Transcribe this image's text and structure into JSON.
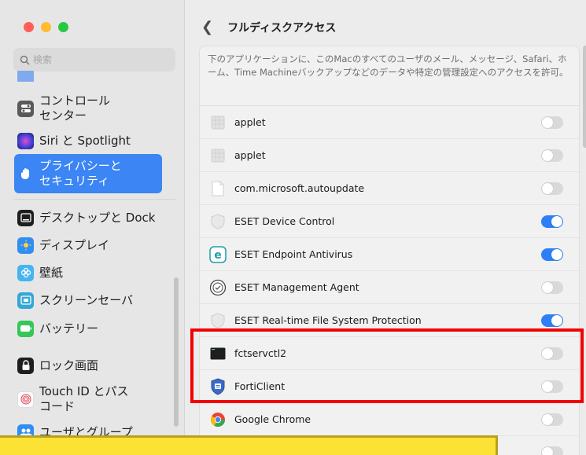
{
  "sidebar": {
    "search_placeholder": "検索",
    "items": [
      {
        "label": "コントロール\nセンター",
        "icon": "control-center-icon",
        "color": "#5a5a5a"
      },
      {
        "label": "Siri と Spotlight",
        "icon": "siri-icon",
        "color": "#2b2b45"
      },
      {
        "label": "プライバシーと\nセキュリティ",
        "icon": "hand-icon",
        "color": "#3b85f4",
        "active": true
      },
      {
        "label": "デスクトップと Dock",
        "icon": "dock-icon",
        "color": "#1e1e1e"
      },
      {
        "label": "ディスプレイ",
        "icon": "display-icon",
        "color": "#2f8df5"
      },
      {
        "label": "壁紙",
        "icon": "wallpaper-icon",
        "color": "#45b5f0"
      },
      {
        "label": "スクリーンセーバ",
        "icon": "screensaver-icon",
        "color": "#35a8d8"
      },
      {
        "label": "バッテリー",
        "icon": "battery-icon",
        "color": "#35c759"
      },
      {
        "label": "ロック画面",
        "icon": "lock-icon",
        "color": "#1e1e1e"
      },
      {
        "label": "Touch ID とパス\nコード",
        "icon": "fingerprint-icon",
        "color": "#ffffff"
      },
      {
        "label": "ユーザとグループ",
        "icon": "users-icon",
        "color": "#2f8df5"
      }
    ]
  },
  "main": {
    "title": "フルディスクアクセス",
    "description": "下のアプリケーションに、このMacのすべてのユーザのメール、メッセージ、Safari、ホーム、Time Machineバックアップなどのデータや特定の管理設定へのアクセスを許可。",
    "apps": [
      {
        "name": "applet",
        "enabled": false,
        "icon": "applet-icon"
      },
      {
        "name": "applet",
        "enabled": false,
        "icon": "applet-icon"
      },
      {
        "name": "com.microsoft.autoupdate",
        "enabled": false,
        "icon": "document-icon"
      },
      {
        "name": "ESET Device Control",
        "enabled": true,
        "icon": "eset-shield-icon"
      },
      {
        "name": "ESET Endpoint Antivirus",
        "enabled": true,
        "icon": "eset-e-icon"
      },
      {
        "name": "ESET Management Agent",
        "enabled": false,
        "icon": "eset-agent-icon"
      },
      {
        "name": "ESET Real-time File System Protection",
        "enabled": true,
        "icon": "eset-shield-icon"
      },
      {
        "name": "fctservctl2",
        "enabled": false,
        "icon": "terminal-icon"
      },
      {
        "name": "FortiClient",
        "enabled": false,
        "icon": "forticlient-icon"
      },
      {
        "name": "Google Chrome",
        "enabled": false,
        "icon": "chrome-icon"
      },
      {
        "name": "",
        "enabled": false,
        "icon": "app-icon"
      }
    ]
  },
  "colors": {
    "accent": "#2d7ff5",
    "highlight_box": "#f30000",
    "yellow_bar": "#fce235"
  }
}
